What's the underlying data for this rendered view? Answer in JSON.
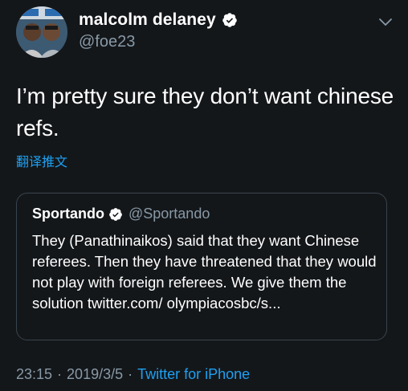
{
  "author": {
    "name": "malcolm delaney",
    "handle": "@foe23",
    "verified": true
  },
  "tweet": {
    "text": "I’m pretty sure they don’t want chinese refs.",
    "translate_label": "翻译推文"
  },
  "quoted": {
    "name": "Sportando",
    "handle": "@Sportando",
    "verified": true,
    "text": "They (Panathinaikos) said that they want Chinese referees. Then they have threatened that they would not play with foreign referees. We give them the solution twitter.com/ olympiacosbc/s..."
  },
  "meta": {
    "time": "23:15",
    "separator": "·",
    "date": "2019/3/5",
    "source": "Twitter for iPhone"
  },
  "colors": {
    "background": "#14171a",
    "accent": "#1da1f2",
    "secondary_text": "#8899a6",
    "border": "#38444d"
  },
  "icons": {
    "verified": "verified-badge-icon",
    "chevron": "chevron-down-icon"
  }
}
